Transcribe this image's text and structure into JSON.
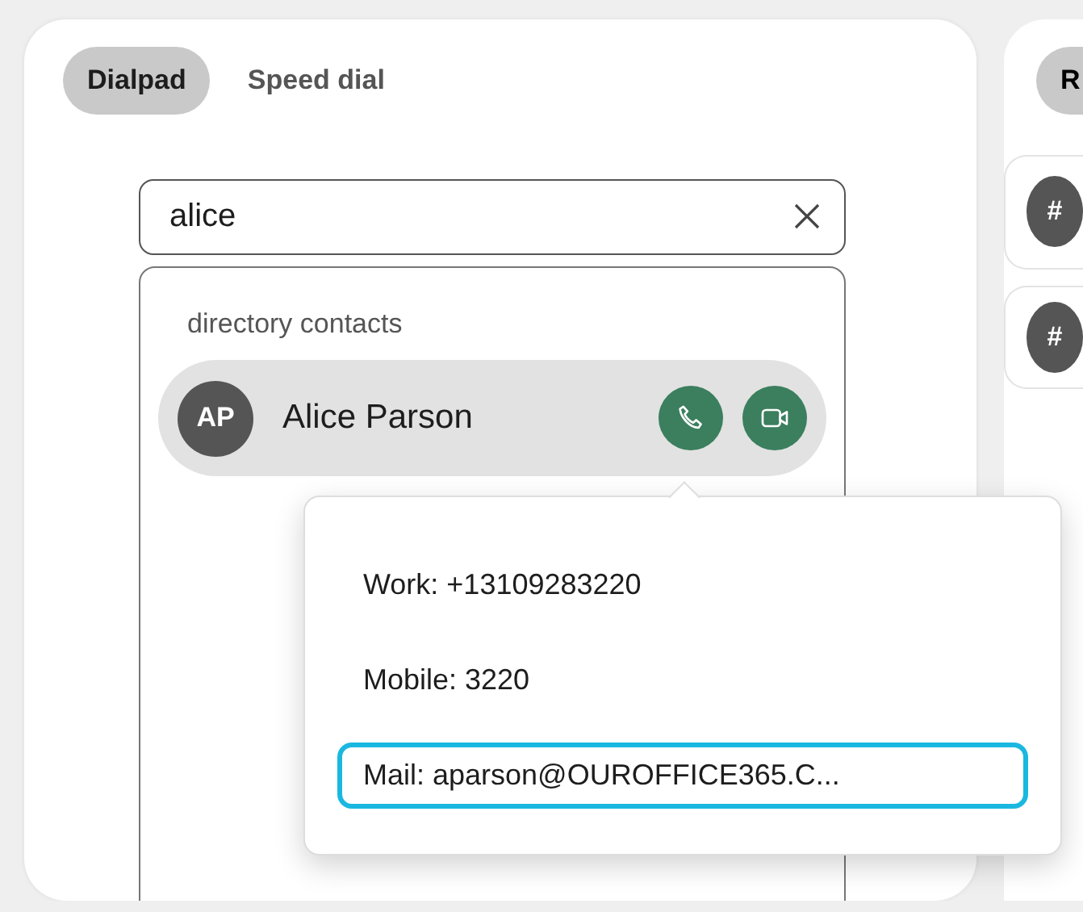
{
  "tabs": [
    {
      "label": "Dialpad",
      "selected": true
    },
    {
      "label": "Speed dial",
      "selected": false
    }
  ],
  "search": {
    "value": "alice"
  },
  "results": {
    "heading": "directory contacts",
    "contacts": [
      {
        "initials": "AP",
        "name": "Alice Parson",
        "selected": true
      }
    ]
  },
  "popover": {
    "items": [
      {
        "label": "Work: +13109283220",
        "focused": false
      },
      {
        "label": "Mobile: 3220",
        "focused": false
      },
      {
        "label": "Mail: aparson@OUROFFICE365.C...",
        "focused": true
      }
    ]
  },
  "side_panel": {
    "tabs": [
      {
        "label": "R",
        "selected": true
      }
    ],
    "cards": [
      {
        "avatar": "#"
      },
      {
        "avatar": "#"
      }
    ]
  }
}
